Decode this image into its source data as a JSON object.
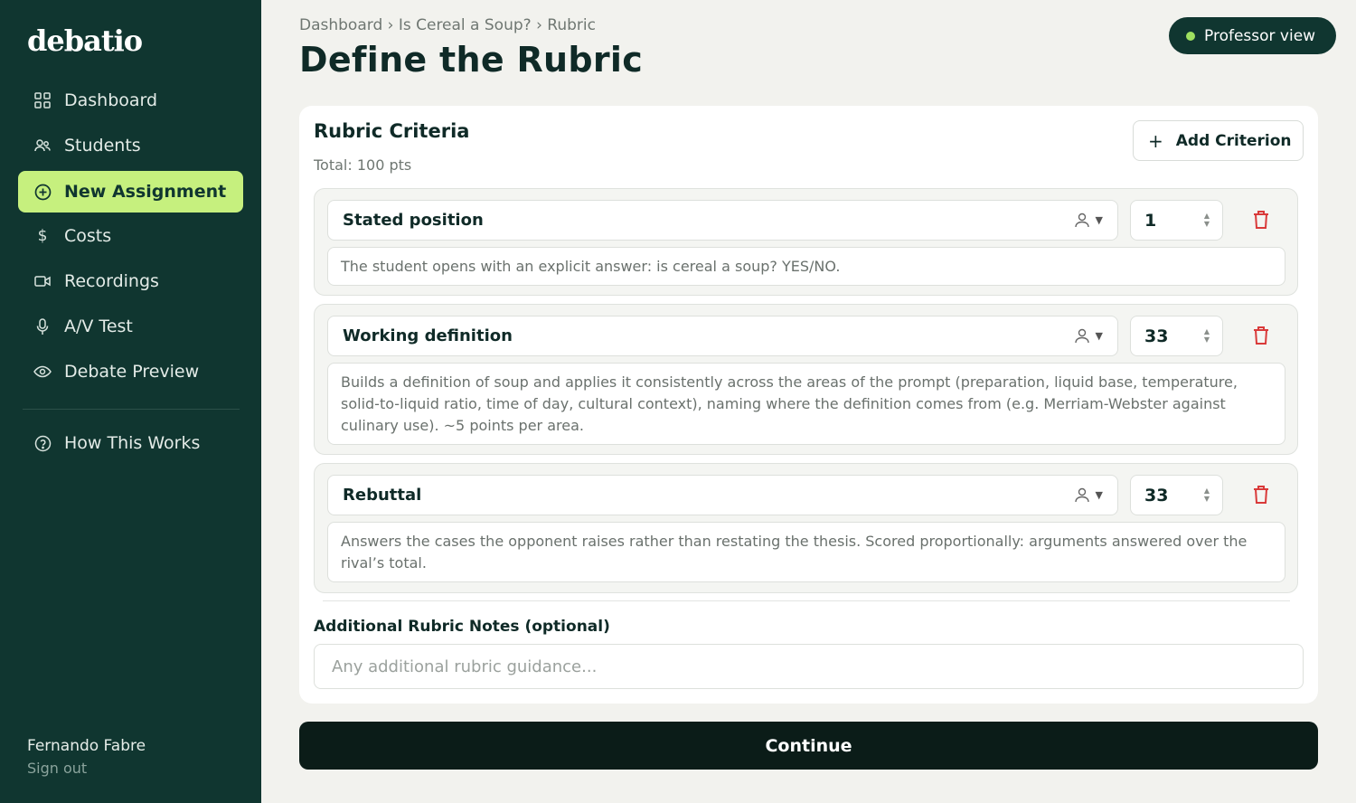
{
  "sidebar": {
    "logo": "debatio",
    "items": [
      {
        "label": "Dashboard",
        "icon": "grid-icon"
      },
      {
        "label": "Students",
        "icon": "users-icon"
      },
      {
        "label": "New Assignment",
        "icon": "plus-circle-icon",
        "active": true
      },
      {
        "label": "Costs",
        "icon": "dollar-icon"
      },
      {
        "label": "Recordings",
        "icon": "video-icon"
      },
      {
        "label": "A/V Test",
        "icon": "microphone-icon"
      },
      {
        "label": "Debate Preview",
        "icon": "eye-icon"
      }
    ],
    "help": {
      "label": "How This Works",
      "icon": "help-circle-icon"
    },
    "user": {
      "name": "Fernando Fabre",
      "sign_out": "Sign out"
    }
  },
  "header": {
    "breadcrumb": "Dashboard › Is Cereal a Soup? › Rubric",
    "title": "Define the Rubric",
    "badge": "Professor view"
  },
  "rubric": {
    "title": "Rubric Criteria",
    "total": "Total: 100 pts",
    "add_label": "Add Criterion",
    "criteria": [
      {
        "name": "Stated position",
        "points": "1",
        "description": "The student opens with an explicit answer: is cereal a soup? YES/NO."
      },
      {
        "name": "Working definition",
        "points": "33",
        "description": "Builds a definition of soup and applies it consistently across the areas of the prompt (preparation, liquid base, temperature, solid-to-liquid ratio, time of day, cultural context), naming where the definition comes from (e.g. Merriam-Webster against culinary use). ~5 points per area."
      },
      {
        "name": "Rebuttal",
        "points": "33",
        "description": "Answers the cases the opponent raises rather than restating the thesis. Scored proportionally: arguments answered over the rival’s total."
      }
    ],
    "notes_label": "Additional Rubric Notes (optional)",
    "notes_placeholder": "Any additional rubric guidance...",
    "notes_value": ""
  },
  "continue_label": "Continue",
  "colors": {
    "sidebar_bg": "#103630",
    "accent": "#c6f07e",
    "danger": "#d93a3a",
    "primary_button": "#0b1c18"
  }
}
